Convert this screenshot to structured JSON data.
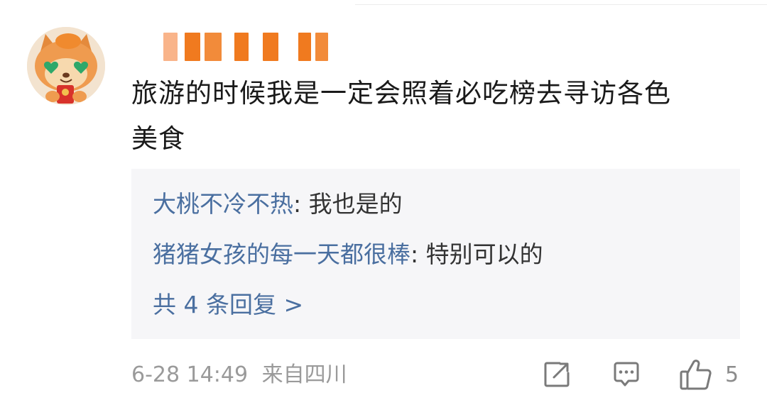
{
  "comment": {
    "username": "",
    "text_line1": "旅游的时候我是一定会照着必吃榜去寻访各色",
    "text_line2": "美食",
    "replies": [
      {
        "author": "大桃不冷不热",
        "separator": ": ",
        "text": "我也是的"
      },
      {
        "author": "猪猪女孩的每一天都很棒",
        "separator": ": ",
        "text": "特别可以的"
      }
    ],
    "view_all_replies": "共 4 条回复 >",
    "date": "6-28 14:49",
    "location": "来自四川",
    "like_count": "5"
  },
  "icons": {
    "repost": "repost-icon",
    "comment": "comment-icon",
    "like": "thumbs-up-icon"
  },
  "colors": {
    "link_blue": "#4a6fa0",
    "reply_bg": "#f6f6f8",
    "username_mosaic": [
      "#f07a1f",
      "#f9b48a",
      "#f28b3a"
    ]
  }
}
